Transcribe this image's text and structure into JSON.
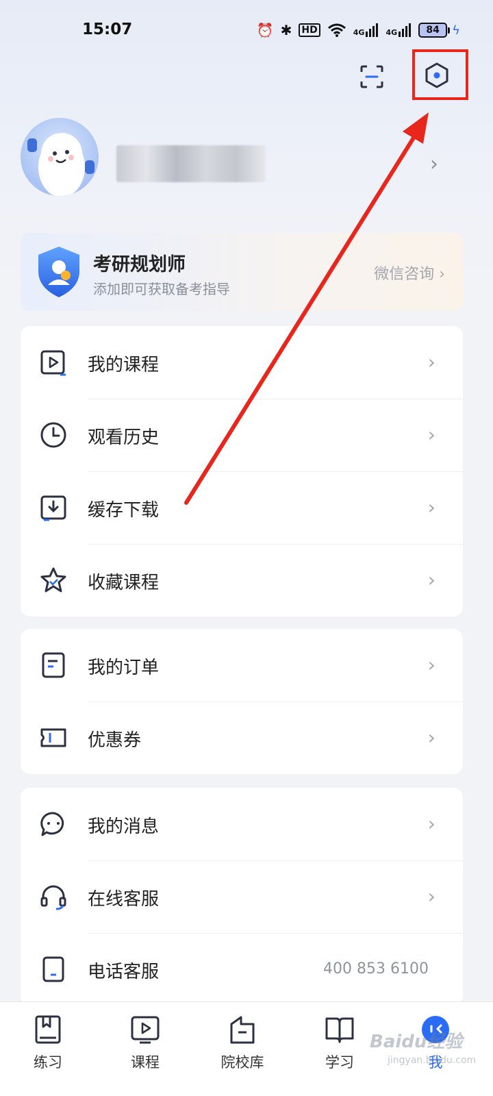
{
  "status_bar": {
    "time": "15:07",
    "hd_label": "HD",
    "signal_1": "4G",
    "signal_2": "4G",
    "battery": "84"
  },
  "header": {
    "scan_icon": "scan-icon",
    "settings_icon": "hexagon-settings-icon"
  },
  "planner": {
    "title": "考研规划师",
    "subtitle": "添加即可获取备考指导",
    "cta": "微信咨询 ›"
  },
  "menu_groups": [
    [
      {
        "label": "我的课程",
        "icon": "play-icon"
      },
      {
        "label": "观看历史",
        "icon": "clock-icon"
      },
      {
        "label": "缓存下载",
        "icon": "download-icon"
      },
      {
        "label": "收藏课程",
        "icon": "star-icon"
      }
    ],
    [
      {
        "label": "我的订单",
        "icon": "order-icon"
      },
      {
        "label": "优惠券",
        "icon": "ticket-icon"
      }
    ],
    [
      {
        "label": "我的消息",
        "icon": "message-icon"
      },
      {
        "label": "在线客服",
        "icon": "headset-icon"
      },
      {
        "label": "电话客服",
        "icon": "phone-icon",
        "value": "400 853 6100"
      }
    ]
  ],
  "tabbar": [
    {
      "label": "练习",
      "icon": "bookmark-book-icon",
      "active": false
    },
    {
      "label": "课程",
      "icon": "video-play-icon",
      "active": false
    },
    {
      "label": "院校库",
      "icon": "school-icon",
      "active": false
    },
    {
      "label": "学习",
      "icon": "open-book-icon",
      "active": false
    },
    {
      "label": "我",
      "icon": "avatar-face-icon",
      "active": true
    }
  ],
  "watermark": {
    "text": "Baidu经验",
    "sub": "jingyan.baidu.com"
  },
  "colors": {
    "accent": "#2a6cf5",
    "annotation": "#e8261c"
  }
}
